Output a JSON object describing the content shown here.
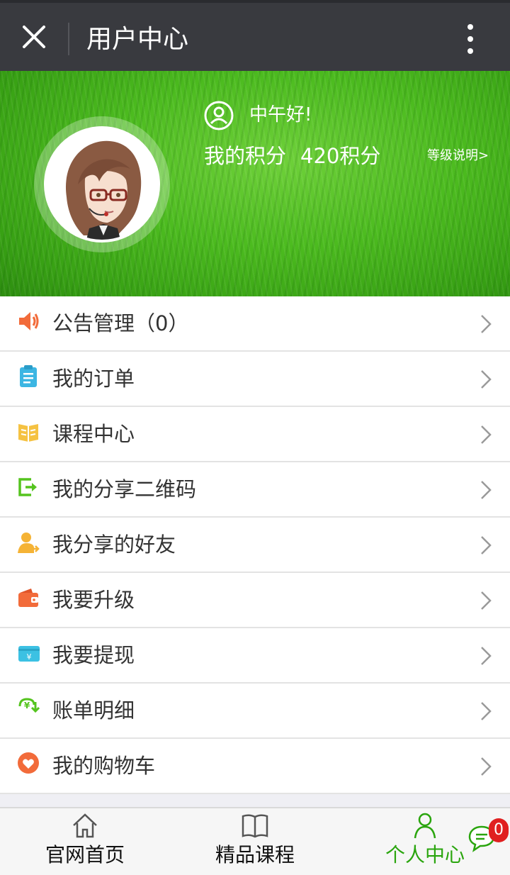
{
  "titlebar": {
    "title": "用户中心",
    "close_icon": "close-icon",
    "more_icon": "more-vertical-icon"
  },
  "profile": {
    "greeting": "中午好!",
    "points_label": "我的积分",
    "points_value": "420积分",
    "level_link": "等级说明>",
    "user_icon": "user-circle-icon"
  },
  "menu": {
    "items": [
      {
        "label": "公告管理（0）",
        "icon": "speaker-icon",
        "color": "#f26b3a"
      },
      {
        "label": "我的订单",
        "icon": "clipboard-icon",
        "color": "#3cb6e3"
      },
      {
        "label": "课程中心",
        "icon": "book-icon",
        "color": "#f5c242"
      },
      {
        "label": "我的分享二维码",
        "icon": "share-icon",
        "color": "#55c41f"
      },
      {
        "label": "我分享的好友",
        "icon": "friend-icon",
        "color": "#f5b335"
      },
      {
        "label": "我要升级",
        "icon": "wallet-icon",
        "color": "#f26b3a"
      },
      {
        "label": "我要提现",
        "icon": "card-icon",
        "color": "#3cc1e3"
      },
      {
        "label": "账单明细",
        "icon": "yuan-icon",
        "color": "#55c41f"
      },
      {
        "label": "我的购物车",
        "icon": "heart-icon",
        "color": "#f26b3a"
      }
    ]
  },
  "tabbar": {
    "tabs": [
      {
        "label": "官网首页",
        "icon": "home-icon"
      },
      {
        "label": "精品课程",
        "icon": "book-open-icon"
      },
      {
        "label": "个人中心",
        "icon": "person-icon",
        "active": true
      }
    ],
    "chat_badge": "0",
    "accent_color": "#2aa50e"
  }
}
